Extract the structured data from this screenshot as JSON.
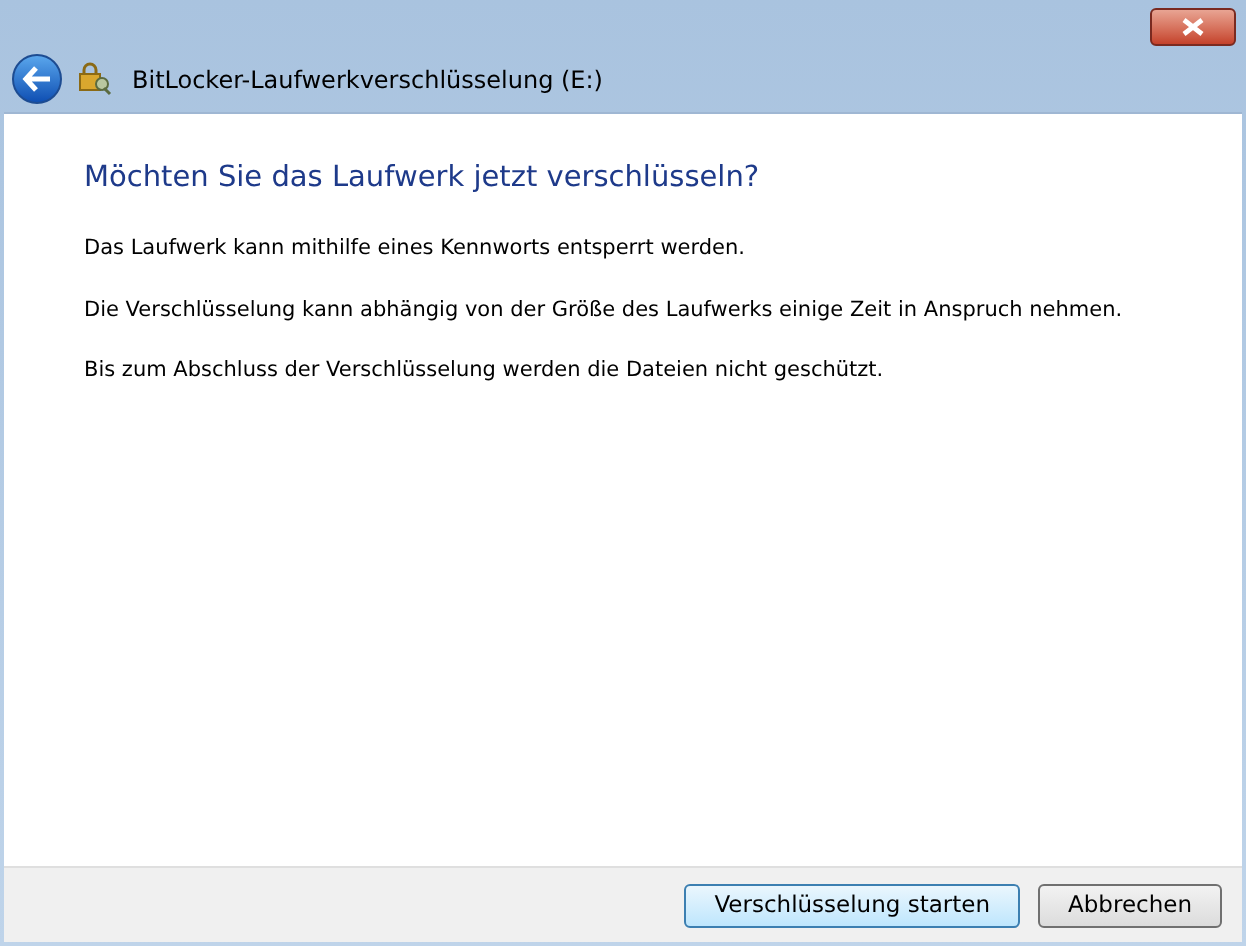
{
  "window": {
    "title": "BitLocker-Laufwerkverschlüsselung (E:)"
  },
  "heading": "Möchten Sie das Laufwerk jetzt verschlüsseln?",
  "paragraphs": [
    "Das Laufwerk kann mithilfe eines Kennworts entsperrt werden.",
    "Die Verschlüsselung kann abhängig von der Größe des Laufwerks einige Zeit in Anspruch nehmen.",
    "Bis zum Abschluss der Verschlüsselung werden die Dateien nicht geschützt."
  ],
  "buttons": [
    {
      "label": "Verschlüsselung starten",
      "default": true
    },
    {
      "label": "Abbrechen",
      "default": false
    }
  ]
}
